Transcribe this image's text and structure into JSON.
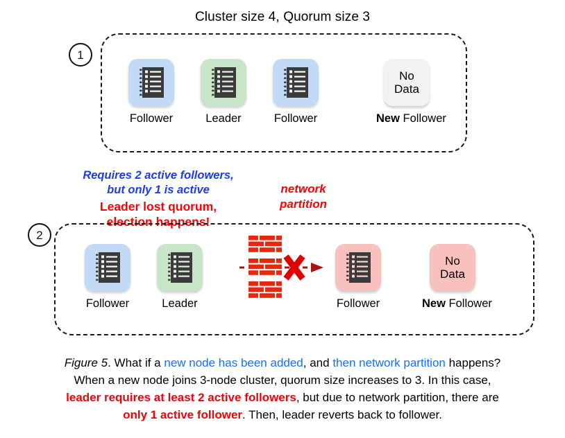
{
  "title": "Cluster size 4, Quorum size 3",
  "steps": [
    {
      "number": "1"
    },
    {
      "number": "2"
    }
  ],
  "colors": {
    "blue_tile": "#c3daf7",
    "green_tile": "#c9e5c8",
    "gray_tile": "#f3f2f1",
    "pink_tile": "#f8c1bd",
    "annotation_blue": "#1a3cf0",
    "annotation_red": "#fb0205",
    "brick_red": "#e8270f",
    "arrow_dark_red": "#a81414",
    "caption_blue": "#1a6dfb",
    "caption_red": "#e8050b"
  },
  "row1": {
    "nodes": [
      {
        "label_prefix": "",
        "label": "Follower",
        "tile": "blue",
        "content": "ledger"
      },
      {
        "label_prefix": "",
        "label": "Leader",
        "tile": "green",
        "content": "ledger"
      },
      {
        "label_prefix": "",
        "label": "Follower",
        "tile": "blue",
        "content": "ledger"
      },
      {
        "label_prefix": "New",
        "label": " Follower",
        "tile": "gray",
        "content": "No Data",
        "content_line1": "No",
        "content_line2": "Data"
      }
    ]
  },
  "row2": {
    "annotation_blue_line1": "Requires 2 active followers,",
    "annotation_blue_line2": "but only 1 is active",
    "annotation_red_line1": "Leader lost quorum,",
    "annotation_red_line2": "election happens!",
    "partition_label_line1": "network",
    "partition_label_line2": "partition",
    "nodes": [
      {
        "label_prefix": "",
        "label": "Follower",
        "tile": "blue",
        "content": "ledger"
      },
      {
        "label_prefix": "",
        "label": "Leader",
        "tile": "green",
        "content": "ledger"
      },
      {
        "label_prefix": "",
        "label": "Follower",
        "tile": "pink",
        "content": "ledger"
      },
      {
        "label_prefix": "New",
        "label": " Follower",
        "tile": "pink",
        "content": "No Data",
        "content_line1": "No",
        "content_line2": "Data"
      }
    ]
  },
  "caption": {
    "figure_label": "Figure 5",
    "seg1": ". What if a ",
    "blue1": "new node has been added",
    "seg2": ", and ",
    "blue2": "then network partition",
    "seg3": " happens?",
    "line2": "When a new node joins 3-node cluster, quorum size increases to 3. In this case,",
    "red1": "leader requires at least 2 active followers",
    "seg4": ", but due to network partition, there are",
    "red2": "only 1 active follower",
    "seg5": ". Then, leader reverts back to follower."
  }
}
